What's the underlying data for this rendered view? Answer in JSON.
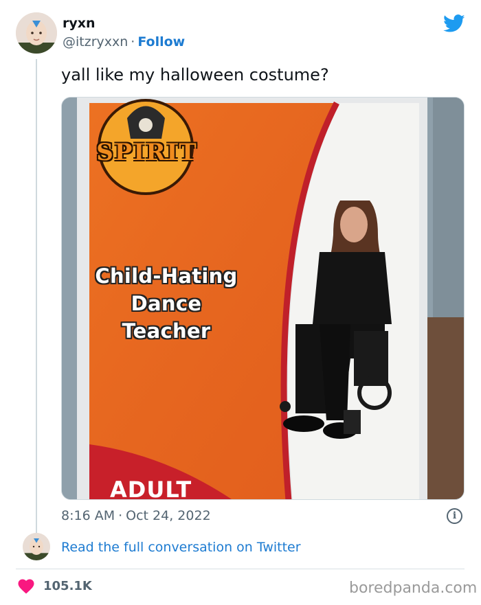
{
  "author": {
    "name": "ryxn",
    "handle": "@itzryxxn",
    "separator": "·",
    "follow_label": "Follow"
  },
  "tweet": {
    "text": "yall like my halloween costume?",
    "time": "8:16 AM",
    "separator": "·",
    "date": "Oct 24, 2022"
  },
  "media": {
    "brand_text": "SPIRIT",
    "costume_title_lines": [
      "Child-Hating",
      "Dance",
      "Teacher"
    ],
    "size_label": "ADULT"
  },
  "footer": {
    "read_link": "Read the full conversation on Twitter",
    "likes": "105.1K",
    "watermark": "boredpanda.com",
    "info_glyph": "i"
  },
  "icons": {
    "platform": "twitter-bird-icon",
    "likes": "heart-icon",
    "info": "info-icon"
  },
  "colors": {
    "link": "#1d7bd1",
    "twitter_blue": "#1d9bf0",
    "heart": "#f91880",
    "secondary_text": "#536471"
  }
}
